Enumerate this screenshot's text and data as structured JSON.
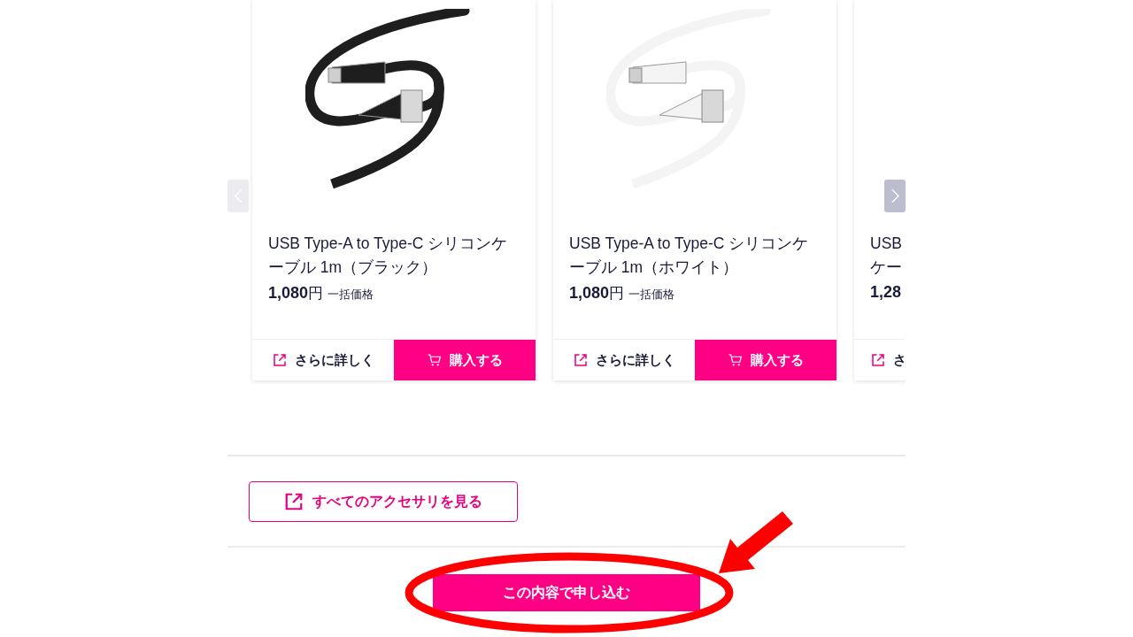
{
  "carousel": {
    "prev_disabled": true,
    "next_disabled": false,
    "cards": [
      {
        "kind": "full",
        "color": "#1e1e1e",
        "title": "USB Type-A to Type-C シリコンケーブル 1m（ブラック）",
        "price": "1,080",
        "unit": "円",
        "note": "一括価格",
        "detail": "さらに詳しく",
        "buy": "購入する"
      },
      {
        "kind": "full",
        "color": "#f4f4f4",
        "title": "USB Type-A to Type-C シリコンケーブル 1m（ホワイト）",
        "price": "1,080",
        "unit": "円",
        "note": "一括価格",
        "detail": "さらに詳しく",
        "buy": "購入する"
      },
      {
        "kind": "clipped",
        "title": "USB ケー",
        "price": "1,28",
        "detail": "さ"
      }
    ]
  },
  "all_accessories_button": "すべてのアクセサリを見る",
  "submit_button": "この内容で申し込む"
}
